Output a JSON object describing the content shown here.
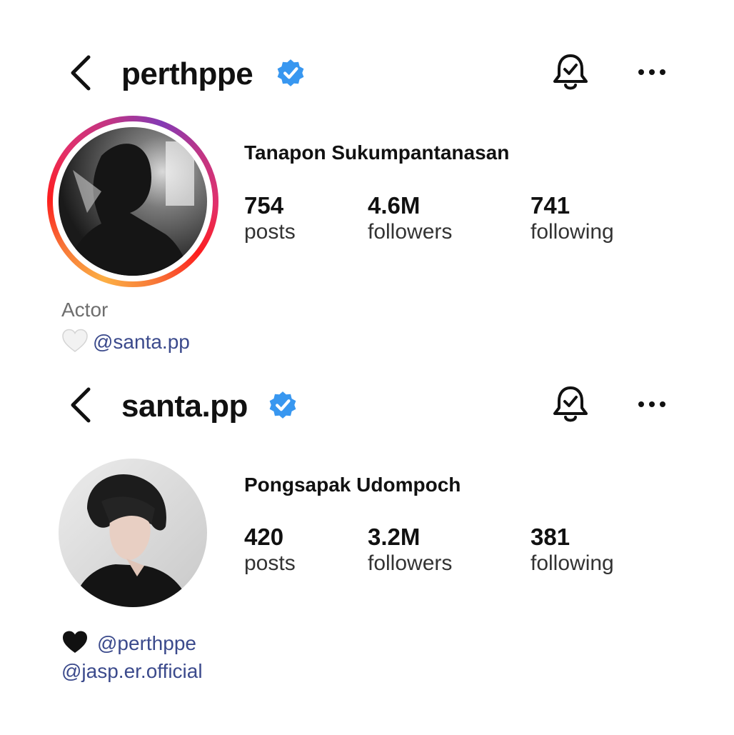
{
  "profiles": [
    {
      "username": "perthppe",
      "full_name": "Tanapon Sukumpantanasan",
      "verified": true,
      "has_story_ring": true,
      "stats": [
        {
          "value": "754",
          "label": "posts"
        },
        {
          "value": "4.6M",
          "label": "followers"
        },
        {
          "value": "741",
          "label": "following"
        }
      ],
      "bio": {
        "category": "Actor",
        "heart_icon": "white-heart-icon",
        "mention": "@santa.pp"
      }
    },
    {
      "username": "santa.pp",
      "full_name": "Pongsapak Udompoch",
      "verified": true,
      "has_story_ring": false,
      "stats": [
        {
          "value": "420",
          "label": "posts"
        },
        {
          "value": "3.2M",
          "label": "followers"
        },
        {
          "value": "381",
          "label": "following"
        }
      ],
      "bio": {
        "heart_icon": "black-heart-icon",
        "mention": "@perthppe",
        "link_mention": "@jasp.er.official"
      }
    }
  ],
  "icons": {
    "back": "chevron-left-icon",
    "verified": "verified-badge-icon",
    "notifications": "bell-icon",
    "more": "more-options-icon"
  },
  "colors": {
    "verified_blue": "#3897f0",
    "mention_blue": "#3b4a8c",
    "muted_text": "#6e6e6e"
  }
}
